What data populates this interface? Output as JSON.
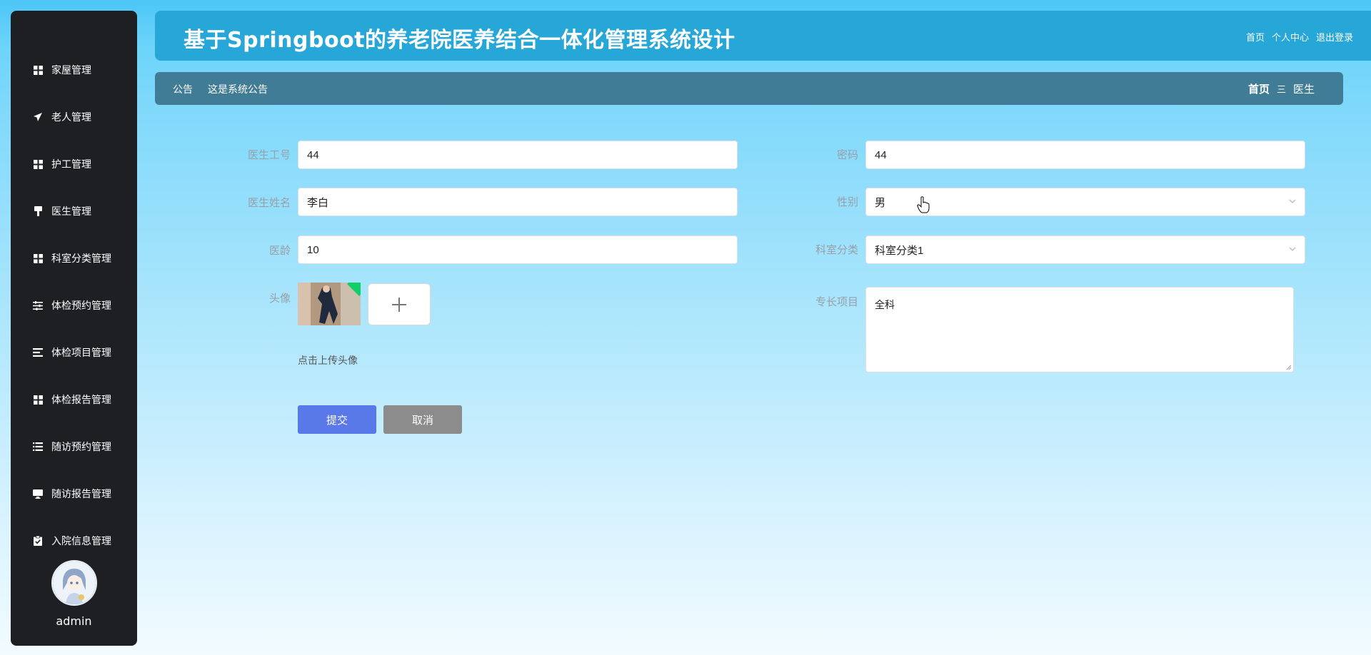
{
  "app": {
    "title": "基于Springboot的养老院医养结合一体化管理系统设计"
  },
  "top_links": [
    "首页",
    "个人中心",
    "退出登录"
  ],
  "notice": {
    "label": "公告",
    "text": "这是系统公告"
  },
  "breadcrumb": {
    "home": "首页",
    "separator": "三",
    "current": "医生"
  },
  "sidebar": {
    "items": [
      {
        "label": "家屋管理",
        "icon": "grid-icon"
      },
      {
        "label": "老人管理",
        "icon": "send-icon"
      },
      {
        "label": "护工管理",
        "icon": "grid-icon"
      },
      {
        "label": "医生管理",
        "icon": "brush-icon"
      },
      {
        "label": "科室分类管理",
        "icon": "grid-icon"
      },
      {
        "label": "体检预约管理",
        "icon": "sliders-icon"
      },
      {
        "label": "体检项目管理",
        "icon": "list-icon"
      },
      {
        "label": "体检报告管理",
        "icon": "grid-icon"
      },
      {
        "label": "随访预约管理",
        "icon": "list-icon"
      },
      {
        "label": "随访报告管理",
        "icon": "monitor-icon"
      },
      {
        "label": "入院信息管理",
        "icon": "clipboard-icon"
      }
    ],
    "user": {
      "name": "admin"
    }
  },
  "form": {
    "doctor_id": {
      "label": "医生工号",
      "value": "44"
    },
    "password": {
      "label": "密码",
      "value": "44"
    },
    "doctor_name": {
      "label": "医生姓名",
      "value": "李白"
    },
    "gender": {
      "label": "性别",
      "value": "男"
    },
    "years": {
      "label": "医龄",
      "value": "10"
    },
    "department": {
      "label": "科室分类",
      "value": "科室分类1"
    },
    "avatar": {
      "label": "头像",
      "hint": "点击上传头像"
    },
    "specialty": {
      "label": "专长项目",
      "value": "全科"
    }
  },
  "buttons": {
    "submit": "提交",
    "cancel": "取消"
  },
  "colors": {
    "sidebar_bg": "#1d1f22",
    "topbar_bg": "#27a6d8",
    "noticebar_bg": "#417c96",
    "submit_bg": "#5a79e8",
    "cancel_bg": "#8c8c8c"
  }
}
